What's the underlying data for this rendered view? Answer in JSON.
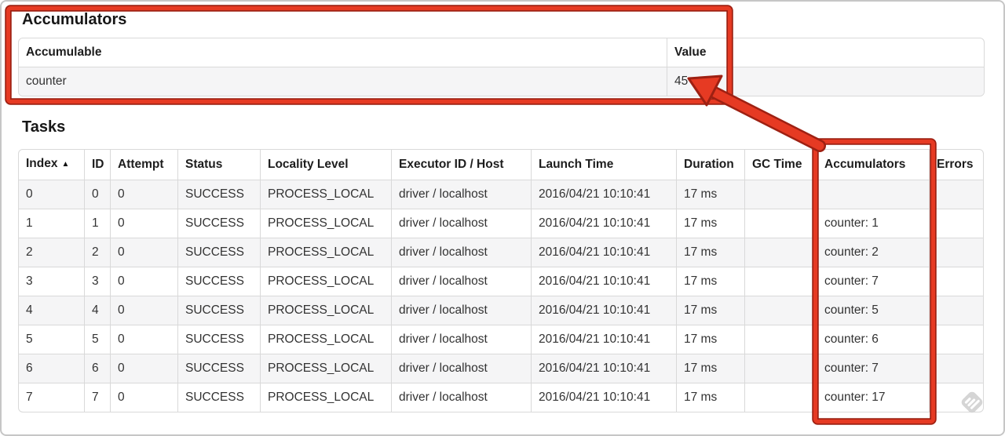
{
  "accumulators_section": {
    "title": "Accumulators",
    "headers": {
      "accumulable": "Accumulable",
      "value": "Value"
    },
    "row": {
      "name": "counter",
      "value": "45"
    }
  },
  "tasks_section": {
    "title": "Tasks",
    "sort_ascending_icon": "▲",
    "headers": [
      "Index",
      "ID",
      "Attempt",
      "Status",
      "Locality Level",
      "Executor ID / Host",
      "Launch Time",
      "Duration",
      "GC Time",
      "Accumulators",
      "Errors"
    ],
    "rows": [
      [
        "0",
        "0",
        "0",
        "SUCCESS",
        "PROCESS_LOCAL",
        "driver / localhost",
        "2016/04/21 10:10:41",
        "17 ms",
        "",
        "",
        ""
      ],
      [
        "1",
        "1",
        "0",
        "SUCCESS",
        "PROCESS_LOCAL",
        "driver / localhost",
        "2016/04/21 10:10:41",
        "17 ms",
        "",
        "counter: 1",
        ""
      ],
      [
        "2",
        "2",
        "0",
        "SUCCESS",
        "PROCESS_LOCAL",
        "driver / localhost",
        "2016/04/21 10:10:41",
        "17 ms",
        "",
        "counter: 2",
        ""
      ],
      [
        "3",
        "3",
        "0",
        "SUCCESS",
        "PROCESS_LOCAL",
        "driver / localhost",
        "2016/04/21 10:10:41",
        "17 ms",
        "",
        "counter: 7",
        ""
      ],
      [
        "4",
        "4",
        "0",
        "SUCCESS",
        "PROCESS_LOCAL",
        "driver / localhost",
        "2016/04/21 10:10:41",
        "17 ms",
        "",
        "counter: 5",
        ""
      ],
      [
        "5",
        "5",
        "0",
        "SUCCESS",
        "PROCESS_LOCAL",
        "driver / localhost",
        "2016/04/21 10:10:41",
        "17 ms",
        "",
        "counter: 6",
        ""
      ],
      [
        "6",
        "6",
        "0",
        "SUCCESS",
        "PROCESS_LOCAL",
        "driver / localhost",
        "2016/04/21 10:10:41",
        "17 ms",
        "",
        "counter: 7",
        ""
      ],
      [
        "7",
        "7",
        "0",
        "SUCCESS",
        "PROCESS_LOCAL",
        "driver / localhost",
        "2016/04/21 10:10:41",
        "17 ms",
        "",
        "counter: 17",
        ""
      ]
    ]
  },
  "annotations": {
    "color": "#e63a23",
    "edge_color": "#9e2012"
  },
  "watermark": {
    "icon": "striped-diamond",
    "color": "#d2d2d2"
  }
}
